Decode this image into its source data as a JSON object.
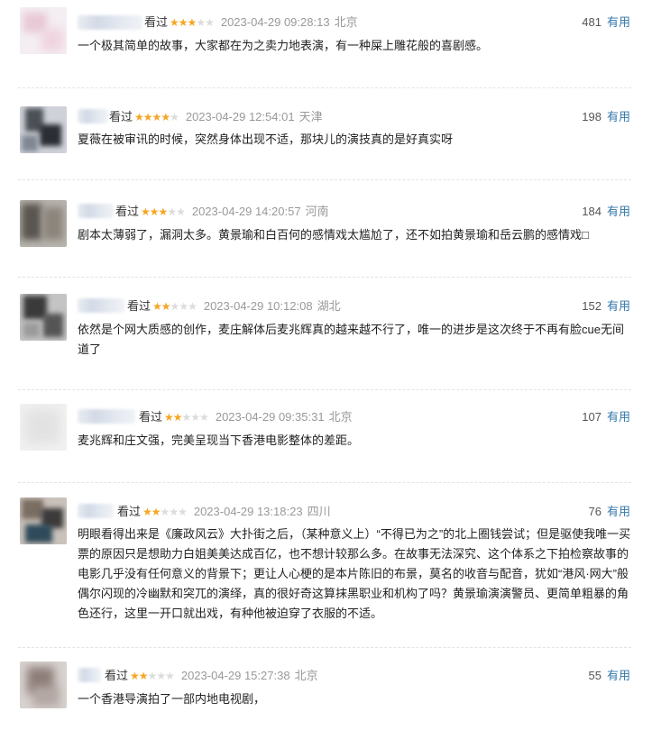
{
  "comments": [
    {
      "status": "看过",
      "rating": 3,
      "time": "2023-04-29 09:28:13",
      "location": "北京",
      "votes": "481",
      "useful_label": "有用",
      "content": "一个极其简单的故事，大家都在为之卖力地表演，有一种屎上雕花般的喜剧感。"
    },
    {
      "status": "看过",
      "rating": 4,
      "time": "2023-04-29 12:54:01",
      "location": "天津",
      "votes": "198",
      "useful_label": "有用",
      "content": "夏薇在被审讯的时候，突然身体出现不适，那块儿的演技真的是好真实呀"
    },
    {
      "status": "看过",
      "rating": 3,
      "time": "2023-04-29 14:20:57",
      "location": "河南",
      "votes": "184",
      "useful_label": "有用",
      "content": "剧本太薄弱了，漏洞太多。黄景瑜和白百何的感情戏太尴尬了，还不如拍黄景瑜和岳云鹏的感情戏□"
    },
    {
      "status": "看过",
      "rating": 2,
      "time": "2023-04-29 10:12:08",
      "location": "湖北",
      "votes": "152",
      "useful_label": "有用",
      "content": "依然是个网大质感的创作，麦庄解体后麦兆辉真的越来越不行了，唯一的进步是这次终于不再有脸cue无间道了"
    },
    {
      "status": "看过",
      "rating": 2,
      "time": "2023-04-29 09:35:31",
      "location": "北京",
      "votes": "107",
      "useful_label": "有用",
      "content": "麦兆辉和庄文强，完美呈现当下香港电影整体的差距。"
    },
    {
      "status": "看过",
      "rating": 2,
      "time": "2023-04-29 13:18:23",
      "location": "四川",
      "votes": "76",
      "useful_label": "有用",
      "content": "明眼看得出来是《廉政风云》大扑街之后，（某种意义上）“不得已为之”的北上圈钱尝试；但是驱使我唯一买票的原因只是想助力白姐美美达成百亿，也不想计较那么多。在故事无法深究、这个体系之下拍检察故事的电影几乎没有任何意义的背景下；更让人心梗的是本片陈旧的布景，莫名的收音与配音，犹如“港风·网大”般偶尔闪现的冷幽默和突兀的演绎，真的很好奇这算抹黑职业和机构了吗？黄景瑜演演警员、更简单粗暴的角色还行，这里一开口就出戏，有种他被迫穿了衣服的不适。"
    },
    {
      "status": "看过",
      "rating": 2,
      "time": "2023-04-29 15:27:38",
      "location": "北京",
      "votes": "55",
      "useful_label": "有用",
      "content": "一个香港导演拍了一部内地电视剧，"
    }
  ]
}
